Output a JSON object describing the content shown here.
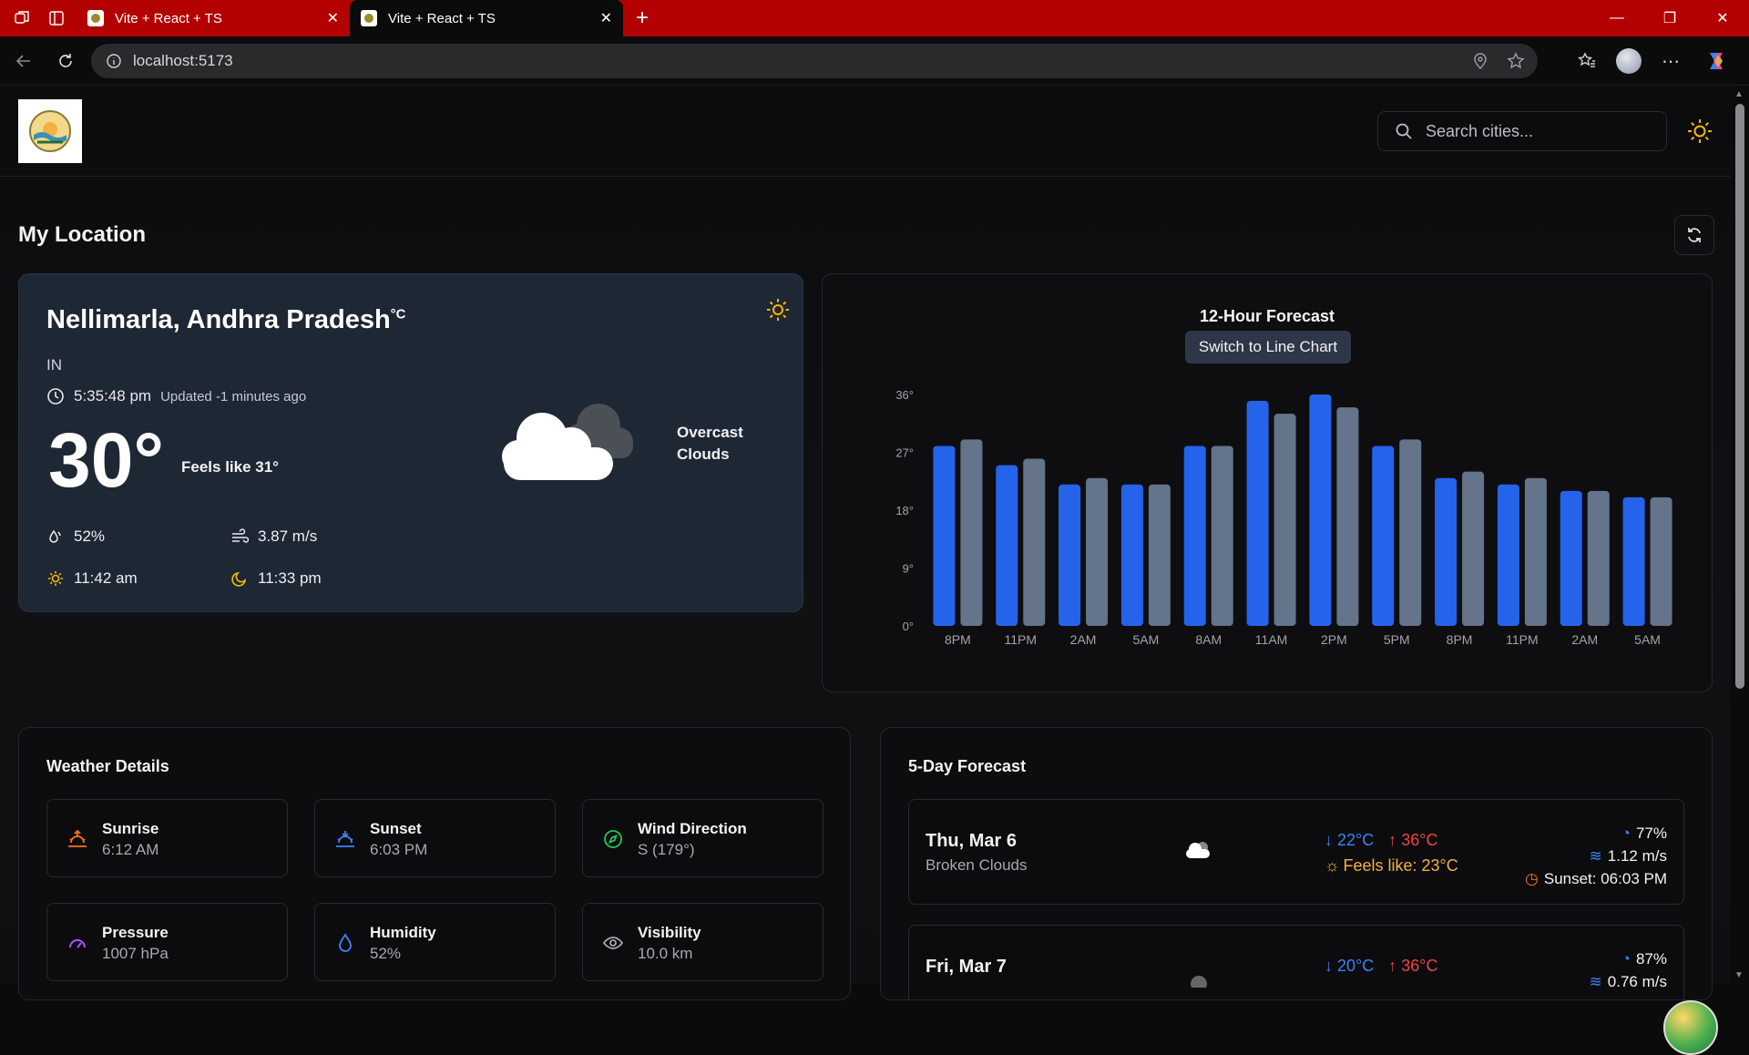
{
  "browser": {
    "tabs": [
      {
        "title": "Vite + React + TS"
      },
      {
        "title": "Vite + React + TS"
      }
    ],
    "url": "localhost:5173"
  },
  "header": {
    "search_placeholder": "Search cities..."
  },
  "page": {
    "section_title": "My Location"
  },
  "current": {
    "city": "Nellimarla, Andhra Pradesh",
    "unit": "°C",
    "country": "IN",
    "time": "5:35:48 pm",
    "updated": "Updated -1 minutes ago",
    "temp": "30°",
    "feels_like": "Feels like 31°",
    "condition": "Overcast Clouds",
    "humidity": "52%",
    "wind": "3.87 m/s",
    "sunrise": "11:42 am",
    "moonrise": "11:33 pm"
  },
  "chart": {
    "title": "12-Hour Forecast",
    "toggle_label": "Switch to Line Chart"
  },
  "chart_data": {
    "type": "bar",
    "title": "12-Hour Forecast",
    "categories": [
      "8PM",
      "11PM",
      "2AM",
      "5AM",
      "8AM",
      "11AM",
      "2PM",
      "5PM",
      "8PM",
      "11PM",
      "2AM",
      "5AM"
    ],
    "y_ticks": [
      "0°",
      "9°",
      "18°",
      "27°",
      "36°"
    ],
    "ylim": [
      0,
      36
    ],
    "grid": false,
    "series": [
      {
        "values": [
          28,
          25,
          22,
          22,
          28,
          35,
          36,
          28,
          23,
          22,
          21,
          20
        ],
        "color": "#2563eb"
      },
      {
        "values": [
          29,
          26,
          23,
          22,
          28,
          33,
          34,
          29,
          24,
          23,
          21,
          20
        ],
        "color": "#64748b"
      }
    ]
  },
  "details": {
    "title": "Weather Details",
    "tiles": [
      {
        "label": "Sunrise",
        "value": "6:12 AM",
        "icon": "sunrise-icon",
        "color": "#f97316"
      },
      {
        "label": "Sunset",
        "value": "6:03 PM",
        "icon": "sunset-icon",
        "color": "#3b82f6"
      },
      {
        "label": "Wind Direction",
        "value": "S (179°)",
        "icon": "compass-icon",
        "color": "#22c55e"
      },
      {
        "label": "Pressure",
        "value": "1007 hPa",
        "icon": "gauge-icon",
        "color": "#a855f7"
      },
      {
        "label": "Humidity",
        "value": "52%",
        "icon": "droplet-icon",
        "color": "#3b82f6"
      },
      {
        "label": "Visibility",
        "value": "10.0 km",
        "icon": "eye-icon",
        "color": "#a9a9ae"
      }
    ]
  },
  "forecast": {
    "title": "5-Day Forecast",
    "days": [
      {
        "name": "Thu, Mar 6",
        "condition": "Broken Clouds",
        "low": "22°C",
        "high": "36°C",
        "feels": "Feels like: 23°C",
        "humidity": "77%",
        "wind": "1.12 m/s",
        "sunset": "Sunset: 06:03 PM"
      },
      {
        "name": "Fri, Mar 7",
        "condition": "",
        "low": "20°C",
        "high": "36°C",
        "feels": "",
        "humidity": "87%",
        "wind": "0.76 m/s",
        "sunset": ""
      }
    ]
  }
}
